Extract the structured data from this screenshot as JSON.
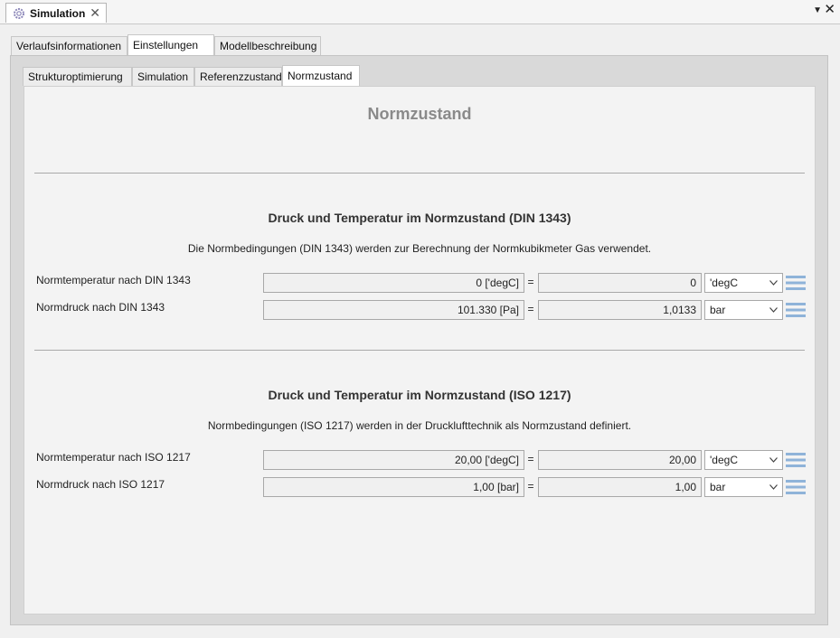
{
  "editor": {
    "tab_title": "Simulation",
    "close_glyph": "✕",
    "view_menu_glyph": "▼",
    "view_close_glyph": "✕"
  },
  "outer_tabs": [
    {
      "label": "Verlaufsinformationen",
      "active": false
    },
    {
      "label": "Einstellungen",
      "active": true
    },
    {
      "label": "Modellbeschreibung",
      "active": false
    }
  ],
  "inner_tabs": [
    {
      "label": "Strukturoptimierung",
      "active": false
    },
    {
      "label": "Simulation",
      "active": false
    },
    {
      "label": "Referenzzustand",
      "active": false
    },
    {
      "label": "Normzustand",
      "active": true
    }
  ],
  "page_title": "Normzustand",
  "sections": [
    {
      "title": "Druck und Temperatur im Normzustand (DIN 1343)",
      "description": "Die Normbedingungen (DIN 1343) werden zur Berechnung der Normkubikmeter Gas verwendet.",
      "rows": [
        {
          "label": "Normtemperatur nach DIN 1343",
          "base_value": "0 ['degC]",
          "eq": "=",
          "value": "0",
          "unit": "'degC"
        },
        {
          "label": "Normdruck nach DIN 1343",
          "base_value": "101.330 [Pa]",
          "eq": "=",
          "value": "1,0133",
          "unit": "bar"
        }
      ]
    },
    {
      "title": "Druck und Temperatur im Normzustand (ISO 1217)",
      "description": "Normbedingungen (ISO 1217) werden in der Drucklufttechnik als Normzustand definiert.",
      "rows": [
        {
          "label": "Normtemperatur nach ISO 1217",
          "base_value": "20,00 ['degC]",
          "eq": "=",
          "value": "20,00",
          "unit": "'degC"
        },
        {
          "label": "Normdruck nach ISO 1217",
          "base_value": "1,00 [bar]",
          "eq": "=",
          "value": "1,00",
          "unit": "bar"
        }
      ]
    }
  ],
  "colors": {
    "title_gray": "#8a8a8a",
    "list_icon_blue": "#8fb3d9"
  }
}
